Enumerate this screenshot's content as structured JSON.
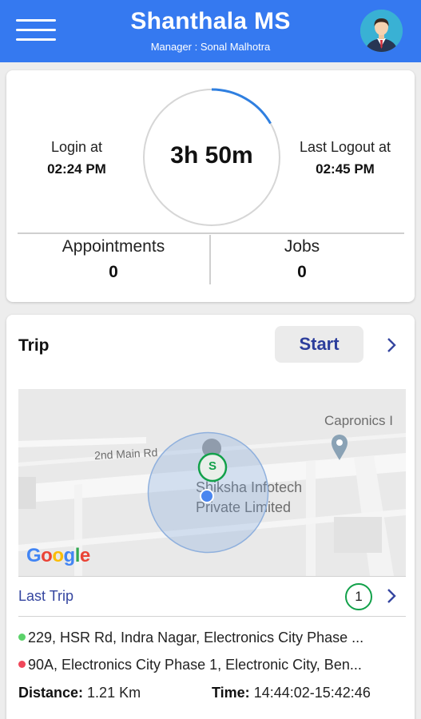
{
  "header": {
    "title": "Shanthala MS",
    "subtitle": "Manager : Sonal Malhotra",
    "accent_color": "#3579f0",
    "menu_icon": "hamburger-menu-icon",
    "avatar_icon": "user-avatar"
  },
  "attendance": {
    "login_label": "Login at",
    "login_time": "02:24 PM",
    "duration": "3h 50m",
    "logout_label": "Last Logout at",
    "logout_time": "02:45 PM",
    "appointments_label": "Appointments",
    "appointments_count": "0",
    "jobs_label": "Jobs",
    "jobs_count": "0"
  },
  "trip": {
    "title": "Trip",
    "start_label": "Start",
    "map": {
      "road_label": "2nd Main Rd",
      "place_1": "Capronics I",
      "place_2_line1": "Shiksha Infotech",
      "place_2_line2": "Private Limited",
      "marker_letter": "S",
      "logo_letters": [
        "G",
        "o",
        "o",
        "g",
        "l",
        "e"
      ],
      "logo_colors": [
        "#4285f4",
        "#ea4335",
        "#fbbc05",
        "#4285f4",
        "#34a853",
        "#ea4335"
      ]
    },
    "last_trip_label": "Last Trip",
    "last_trip_count": "1",
    "start_address": "229, HSR Rd, Indra Nagar, Electronics City Phase ...",
    "end_address": "90A, Electronics City Phase 1, Electronic City, Ben...",
    "start_dot_color": "#5bd26a",
    "end_dot_color": "#f0475a",
    "distance_label": "Distance:",
    "distance_value": "1.21 Km",
    "time_label": "Time:",
    "time_value": "14:44:02-15:42:46"
  }
}
